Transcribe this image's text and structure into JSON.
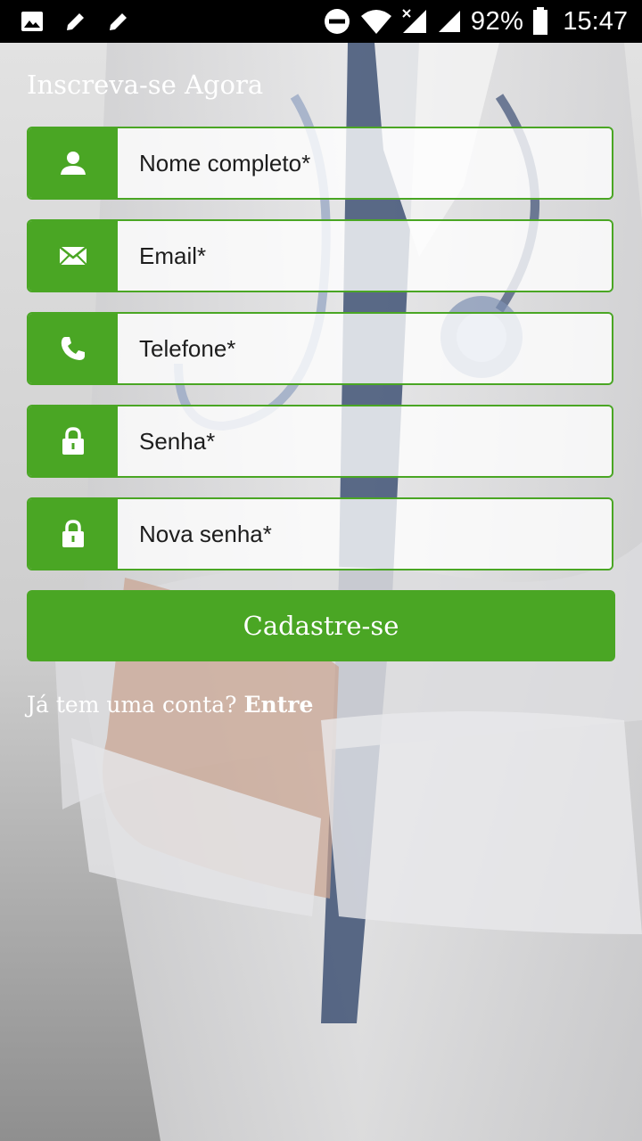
{
  "status_bar": {
    "battery": "92%",
    "time": "15:47",
    "left_icons": [
      "image-icon",
      "pencil-icon",
      "pencil-icon"
    ],
    "right_icons": [
      "do-not-disturb-icon",
      "wifi-icon",
      "signal-icon",
      "signal-icon",
      "battery-icon"
    ]
  },
  "form": {
    "title": "Inscreva-se Agora",
    "fields": [
      {
        "icon": "user-icon",
        "placeholder": "Nome completo*"
      },
      {
        "icon": "mail-icon",
        "placeholder": "Email*"
      },
      {
        "icon": "phone-icon",
        "placeholder": "Telefone*"
      },
      {
        "icon": "lock-icon",
        "placeholder": "Senha*"
      },
      {
        "icon": "lock-icon",
        "placeholder": "Nova senha*"
      }
    ],
    "submit_label": "Cadastre-se",
    "login_prompt": "Já tem uma conta?",
    "login_link": "Entre"
  },
  "colors": {
    "accent": "#4aa624",
    "status_bar": "#000000"
  }
}
